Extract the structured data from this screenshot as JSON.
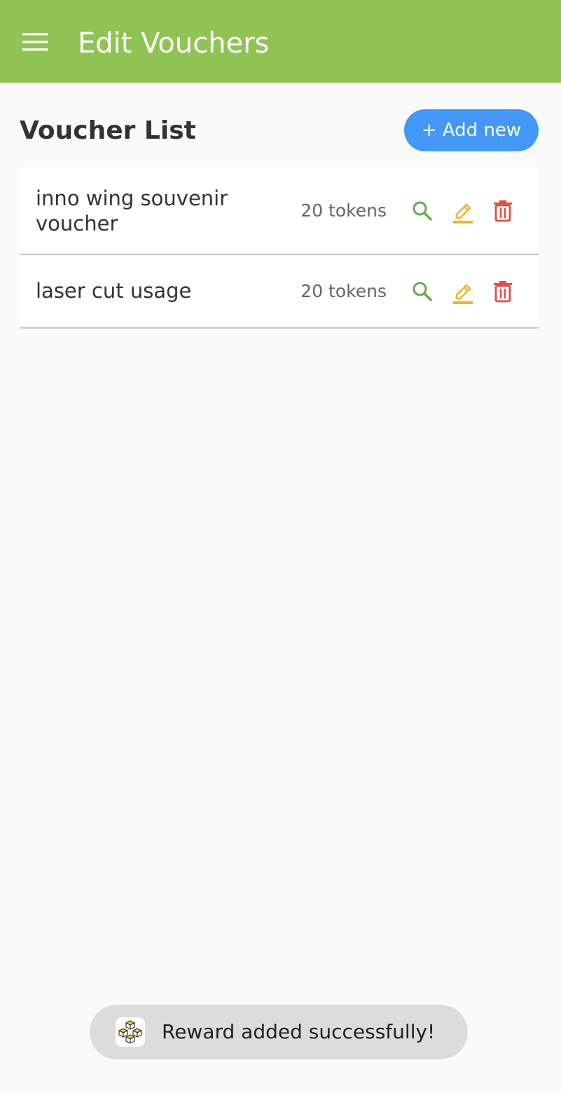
{
  "appbar": {
    "title": "Edit Vouchers",
    "menu_icon": "menu-icon",
    "color": "#8fc454"
  },
  "main": {
    "section_title": "Voucher List",
    "add_button_label": "+ Add new",
    "add_button_color": "#4398f5"
  },
  "vouchers": [
    {
      "name": "inno wing souvenir voucher",
      "tokens": "20 tokens"
    },
    {
      "name": "laser cut usage",
      "tokens": "20 tokens"
    }
  ],
  "row_actions": {
    "view_icon": "search-icon",
    "edit_icon": "pencil-icon",
    "delete_icon": "trash-icon",
    "view_color": "#6aa84f",
    "edit_color": "#f0b429",
    "delete_color": "#e25041"
  },
  "toast": {
    "message": "Reward added successfully!",
    "icon": "app-logo-icon"
  }
}
